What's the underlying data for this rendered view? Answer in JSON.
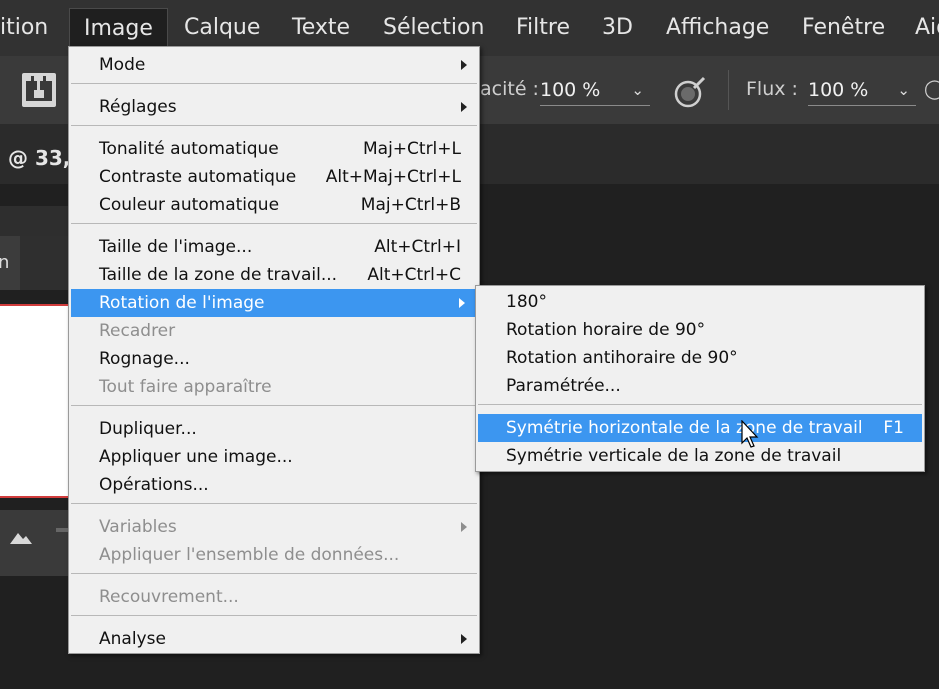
{
  "menubar": {
    "items": [
      "ition",
      "Image",
      "Calque",
      "Texte",
      "Sélection",
      "Filtre",
      "3D",
      "Affichage",
      "Fenêtre",
      "Aid"
    ]
  },
  "options": {
    "opacity_label": "acité :",
    "opacity_value": "100 %",
    "flow_label": "Flux :",
    "flow_value": "100 %"
  },
  "doc": {
    "tab_text": "@ 33,",
    "panel_letter": "n"
  },
  "image_menu": {
    "mode": "Mode",
    "reglages": "Réglages",
    "tonalite": "Tonalité automatique",
    "tonalite_sc": "Maj+Ctrl+L",
    "contraste": "Contraste automatique",
    "contraste_sc": "Alt+Maj+Ctrl+L",
    "couleur": "Couleur automatique",
    "couleur_sc": "Maj+Ctrl+B",
    "taille_image": "Taille de l'image...",
    "taille_image_sc": "Alt+Ctrl+I",
    "taille_zone": "Taille de la zone de travail...",
    "taille_zone_sc": "Alt+Ctrl+C",
    "rotation": "Rotation de l'image",
    "recadrer": "Recadrer",
    "rognage": "Rognage...",
    "tout_faire": "Tout faire apparaître",
    "dupliquer": "Dupliquer...",
    "appliquer_image": "Appliquer une image...",
    "operations": "Opérations...",
    "variables": "Variables",
    "appliquer_ensemble": "Appliquer l'ensemble de données...",
    "recouvrement": "Recouvrement...",
    "analyse": "Analyse"
  },
  "rotation_submenu": {
    "r180": "180°",
    "horaire": "Rotation horaire de 90°",
    "antihoraire": "Rotation antihoraire de 90°",
    "parametree": "Paramétrée...",
    "sym_h": "Symétrie horizontale de la zone de travail",
    "sym_h_sc": "F1",
    "sym_v": "Symétrie verticale de la zone de travail"
  },
  "colors": {
    "highlight": "#3c96f0",
    "menu_bg": "#f0f0f0",
    "app_bg": "#202020"
  }
}
